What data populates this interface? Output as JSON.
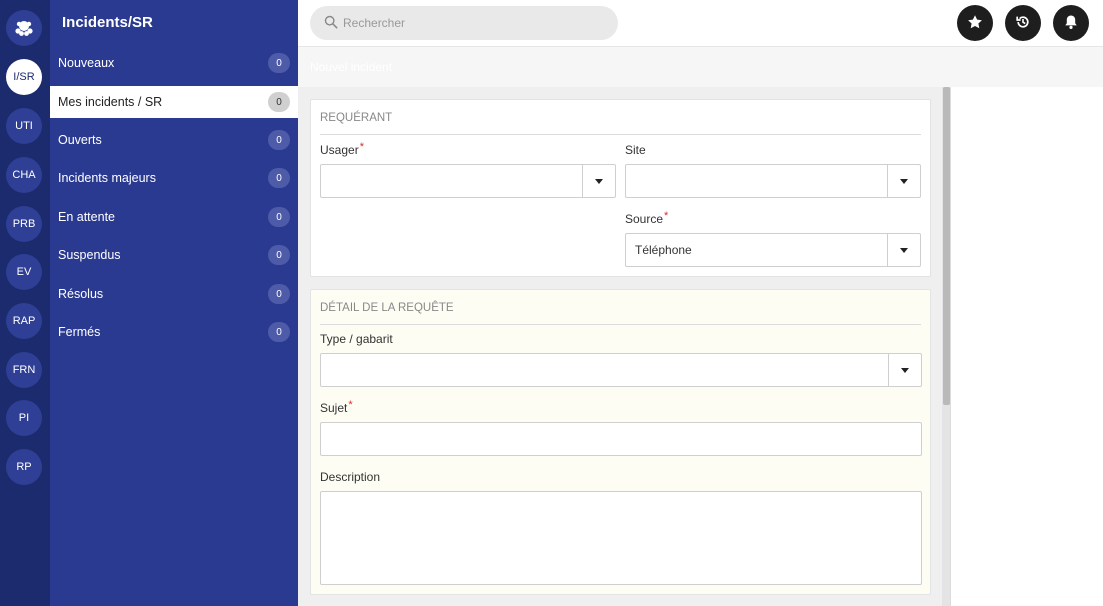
{
  "rail": {
    "logo_icon": "octopus-logo-icon",
    "items": [
      {
        "label": "I/SR",
        "active": true
      },
      {
        "label": "UTI"
      },
      {
        "label": "CHA"
      },
      {
        "label": "PRB"
      },
      {
        "label": "EV"
      },
      {
        "label": "RAP"
      },
      {
        "label": "FRN"
      },
      {
        "label": "PI"
      },
      {
        "label": "RP"
      }
    ]
  },
  "sidebar": {
    "title": "Incidents/SR",
    "items": [
      {
        "label": "Nouveaux",
        "count": "0"
      },
      {
        "label": "Mes incidents / SR",
        "count": "0",
        "active": true
      },
      {
        "label": "Ouverts",
        "count": "0"
      },
      {
        "label": "Incidents majeurs",
        "count": "0"
      },
      {
        "label": "En attente",
        "count": "0"
      },
      {
        "label": "Suspendus",
        "count": "0"
      },
      {
        "label": "Résolus",
        "count": "0"
      },
      {
        "label": "Fermés",
        "count": "0"
      }
    ]
  },
  "topbar": {
    "search_placeholder": "Rechercher",
    "search_icon": "search-icon",
    "buttons": [
      "star-icon",
      "history-icon",
      "bell-icon"
    ]
  },
  "subheader": {
    "title": "Nouvel incident"
  },
  "requerant": {
    "title": "Requérant",
    "usager_label": "Usager",
    "usager_value": "",
    "site_label": "Site",
    "site_value": "",
    "source_label": "Source",
    "source_value": "Téléphone"
  },
  "detail": {
    "title": "Détail de la requête",
    "type_label": "Type / gabarit",
    "type_value": "",
    "sujet_label": "Sujet",
    "sujet_value": "",
    "description_label": "Description",
    "description_value": ""
  },
  "required_marker": "*",
  "colors": {
    "rail_bg": "#1c2a6e",
    "sidebar_bg": "#2b3a91",
    "required": "#d32f2f",
    "topbar_button": "#1e1e1e"
  }
}
